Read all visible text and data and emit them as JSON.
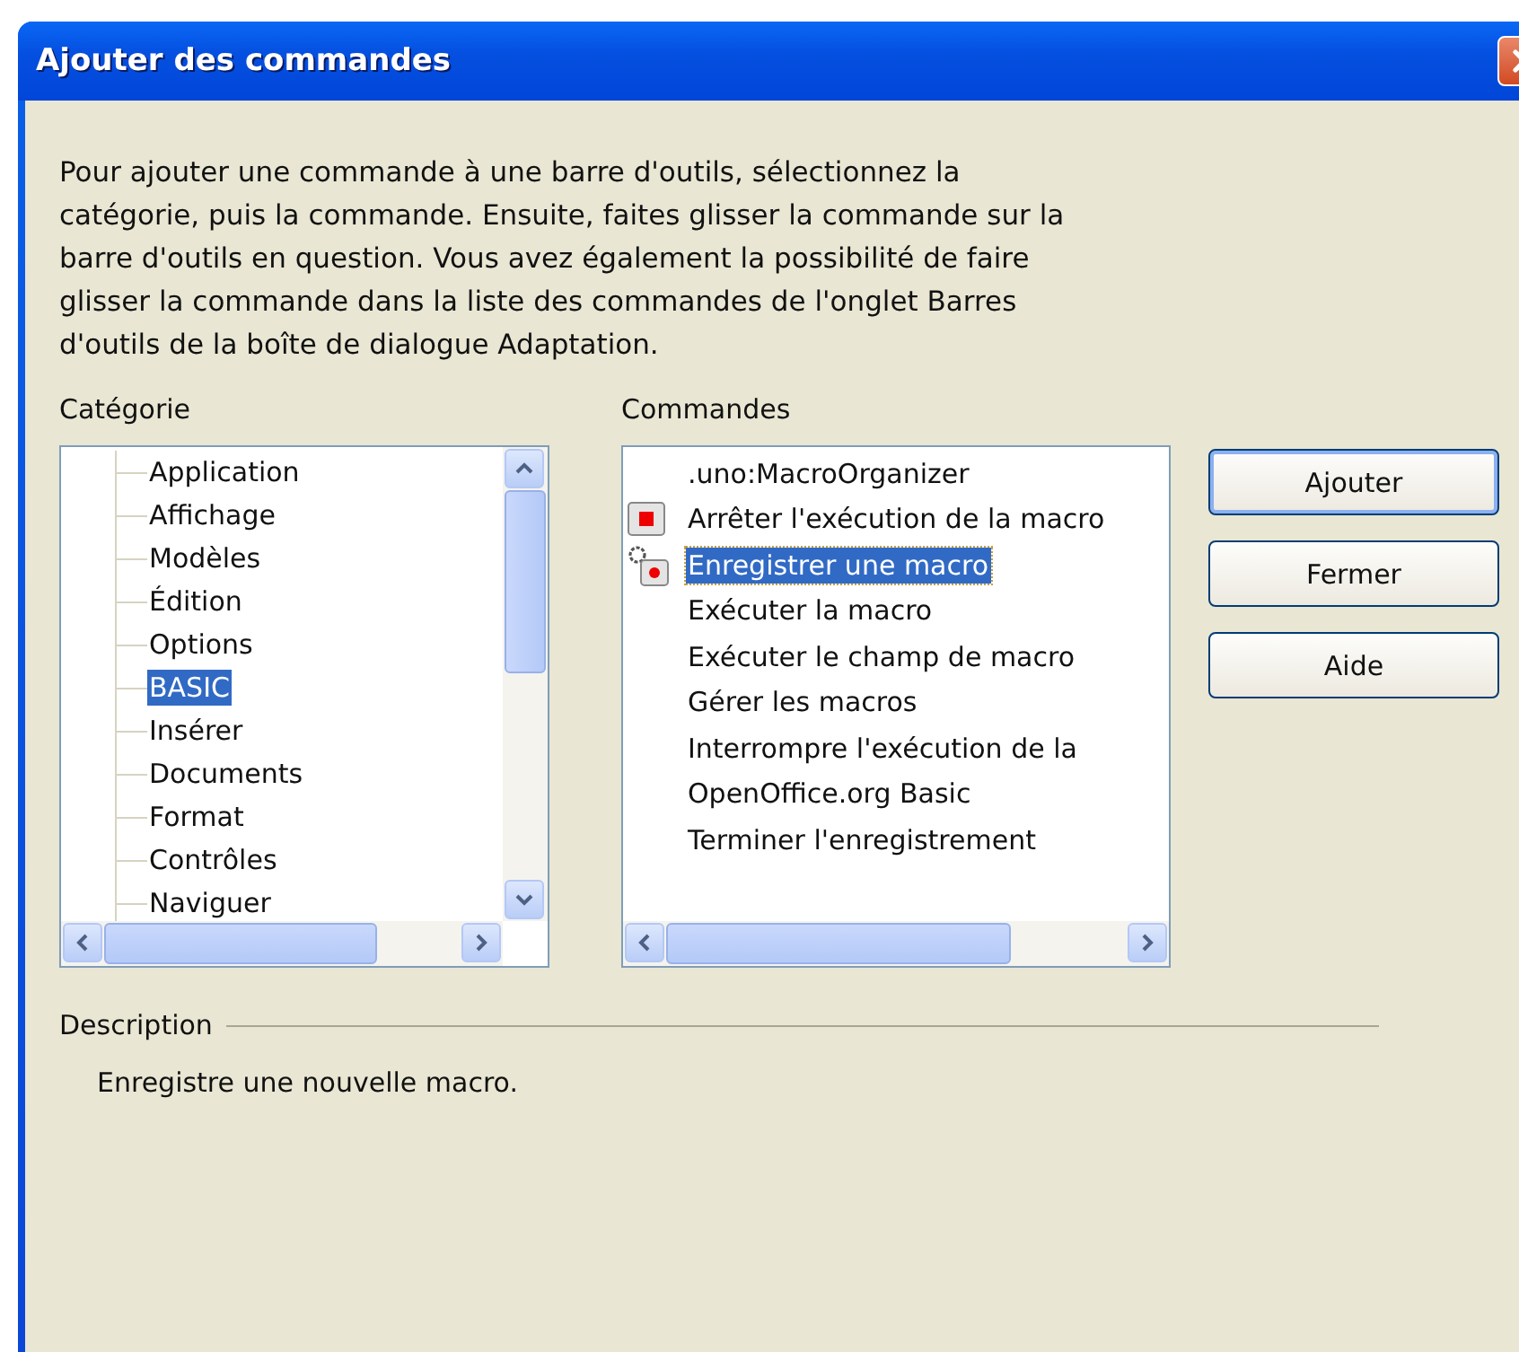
{
  "window": {
    "title": "Ajouter des commandes"
  },
  "intro": "Pour ajouter une commande à une barre d'outils, sélectionnez la catégorie, puis la commande. Ensuite, faites glisser la commande sur la barre d'outils en question. Vous avez également la possibilité de faire glisser la commande dans la liste des commandes de l'onglet Barres d'outils de la boîte de dialogue Adaptation.",
  "category": {
    "label": "Catégorie",
    "items": [
      {
        "label": "Application",
        "selected": false
      },
      {
        "label": "Affichage",
        "selected": false
      },
      {
        "label": "Modèles",
        "selected": false
      },
      {
        "label": "Édition",
        "selected": false
      },
      {
        "label": "Options",
        "selected": false
      },
      {
        "label": "BASIC",
        "selected": true
      },
      {
        "label": "Insérer",
        "selected": false
      },
      {
        "label": "Documents",
        "selected": false
      },
      {
        "label": "Format",
        "selected": false
      },
      {
        "label": "Contrôles",
        "selected": false
      },
      {
        "label": "Naviguer",
        "selected": false
      }
    ]
  },
  "commands": {
    "label": "Commandes",
    "items": [
      {
        "label": ".uno:MacroOrganizer",
        "kind": "plain",
        "selected": false
      },
      {
        "label": "Arrêter l'exécution de la macro",
        "kind": "stop",
        "selected": false
      },
      {
        "label": "Enregistrer une macro",
        "kind": "record",
        "selected": true
      },
      {
        "label": "Exécuter la macro",
        "kind": "plain",
        "selected": false
      },
      {
        "label": "Exécuter le champ de macro",
        "kind": "plain",
        "selected": false
      },
      {
        "label": "Gérer les macros",
        "kind": "plain",
        "selected": false
      },
      {
        "label": "Interrompre l'exécution de la",
        "kind": "plain",
        "selected": false
      },
      {
        "label": "OpenOffice.org Basic",
        "kind": "plain",
        "selected": false
      },
      {
        "label": "Terminer l'enregistrement",
        "kind": "plain",
        "selected": false
      }
    ]
  },
  "buttons": [
    "Ajouter",
    "Fermer",
    "Aide"
  ],
  "description": {
    "label": "Description",
    "text": "Enregistre une nouvelle macro."
  }
}
